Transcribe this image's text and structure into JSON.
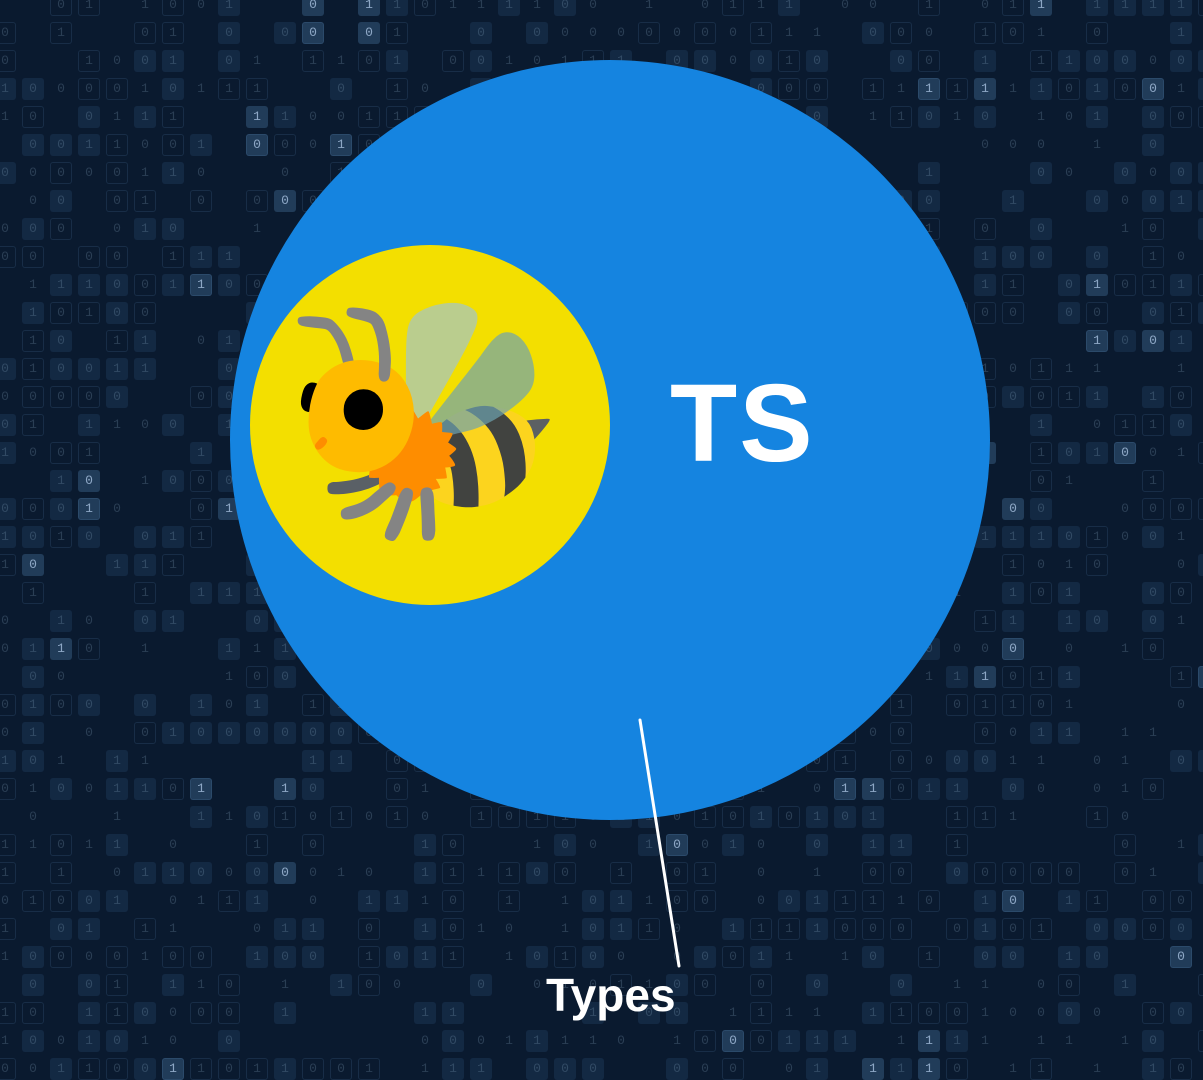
{
  "diagram": {
    "outer_label": "TS",
    "inner_icon_name": "bee-icon",
    "inner_icon_glyph": "🐝",
    "callout_label": "Types",
    "colors": {
      "background": "#0a1a2f",
      "outer_circle": "#1584e0",
      "inner_circle": "#f3df00",
      "text": "#ffffff"
    }
  }
}
